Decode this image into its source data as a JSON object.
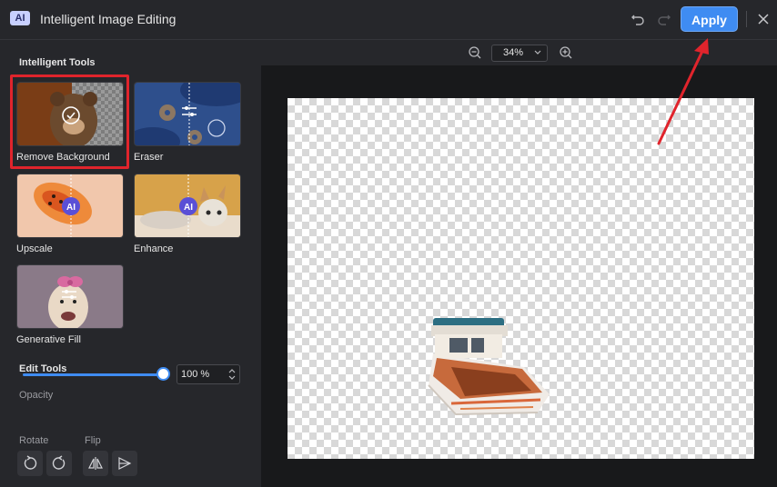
{
  "window": {
    "badge": "AI",
    "title": "Intelligent Image Editing",
    "apply_label": "Apply"
  },
  "panel": {
    "intelligent_tools_title": "Intelligent Tools",
    "tools": [
      {
        "label": "Remove Background",
        "selected": true
      },
      {
        "label": "Eraser"
      },
      {
        "label": "Upscale",
        "badge": "AI"
      },
      {
        "label": "Enhance",
        "badge": "AI"
      },
      {
        "label": "Generative Fill"
      }
    ],
    "edit_tools_title": "Edit Tools",
    "opacity_label": "Opacity",
    "opacity_value": "100 %",
    "opacity_level": 1.0,
    "rotate_label": "Rotate",
    "flip_label": "Flip"
  },
  "canvas": {
    "zoom": "34%"
  },
  "colors": {
    "accent": "#3f8cf2",
    "highlight_box": "#e0242c",
    "annotation_arrow": "#e0242c"
  }
}
